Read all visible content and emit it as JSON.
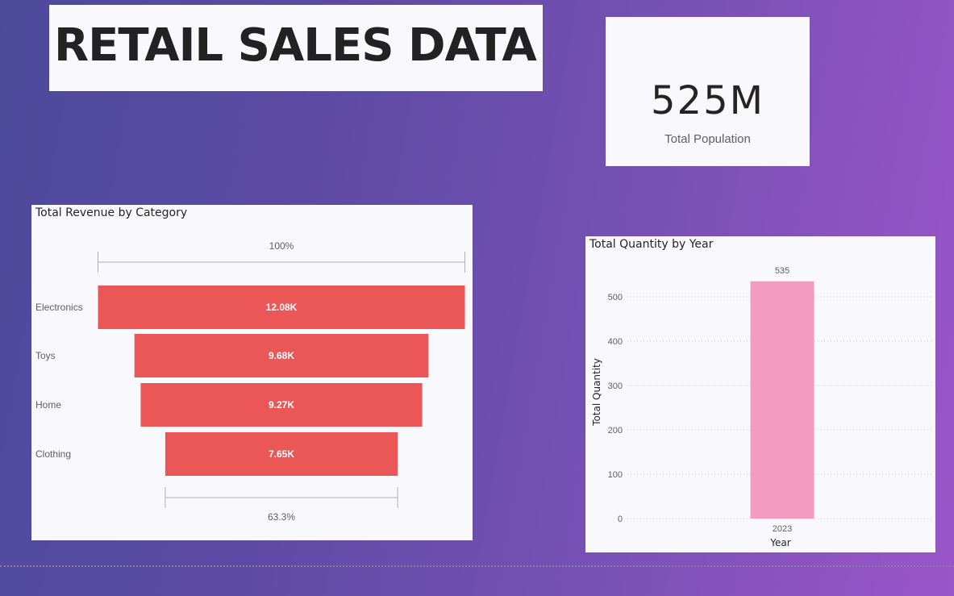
{
  "header": {
    "title": "RETAIL SALES DATA"
  },
  "kpi": {
    "value": "525M",
    "label": "Total Population"
  },
  "funnel": {
    "title": "Total Revenue by Category",
    "top_percent_label": "100%",
    "bottom_percent_label": "63.3%",
    "bar_color": "#eb5757"
  },
  "bar": {
    "title": "Total Quantity by Year",
    "bar_color": "#f49cc0"
  },
  "chart_data": [
    {
      "type": "bar",
      "subtype": "funnel",
      "title": "Total Revenue by Category",
      "categories": [
        "Electronics",
        "Toys",
        "Home",
        "Clothing"
      ],
      "values": [
        12080,
        9680,
        9270,
        7650
      ],
      "labels": [
        "12.08K",
        "9.68K",
        "9.27K",
        "7.65K"
      ],
      "annotations": {
        "first_pct": "100%",
        "last_pct": "63.3%"
      },
      "color": "#eb5757"
    },
    {
      "type": "bar",
      "title": "Total Quantity by Year",
      "categories": [
        "2023"
      ],
      "values": [
        535
      ],
      "labels": [
        "535"
      ],
      "xlabel": "Year",
      "ylabel": "Total Quantity",
      "ylim": [
        0,
        535
      ],
      "yticks": [
        0,
        100,
        200,
        300,
        400,
        500
      ],
      "grid": true,
      "color": "#f49cc0"
    }
  ]
}
